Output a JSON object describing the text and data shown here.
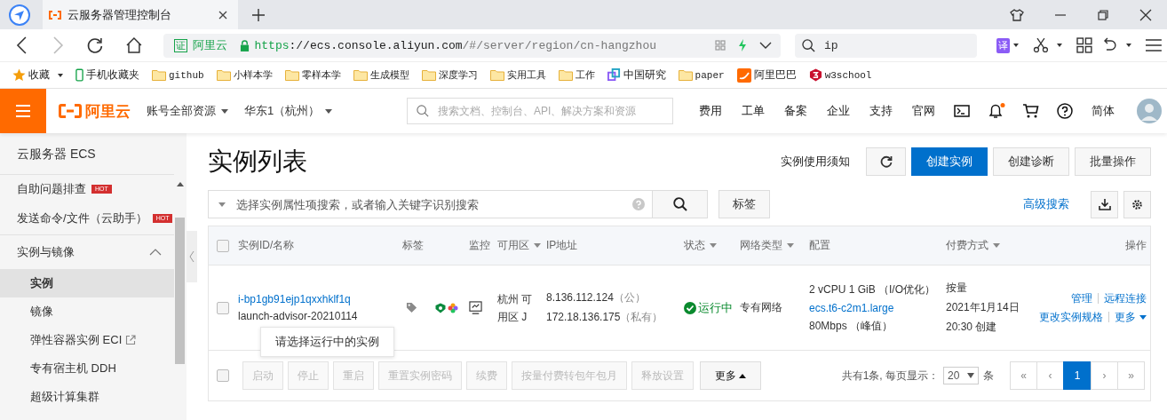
{
  "browser": {
    "tab_title": "云服务器管理控制台",
    "cert_badge": "证",
    "site_name": "阿里云",
    "url_scheme": "https",
    "url_host": "://ecs.console.aliyun.com",
    "url_path": "/#/server/region/cn-hangzhou",
    "search_value": "ip",
    "translate_badge": "译",
    "bookmarks": [
      {
        "kind": "star",
        "label": "收藏"
      },
      {
        "kind": "phone",
        "label": "手机收藏夹"
      },
      {
        "kind": "folder",
        "label": "github"
      },
      {
        "kind": "folder",
        "label": "小样本学"
      },
      {
        "kind": "folder",
        "label": "零样本学"
      },
      {
        "kind": "folder",
        "label": "生成模型"
      },
      {
        "kind": "folder",
        "label": "深度学习"
      },
      {
        "kind": "folder",
        "label": "实用工具"
      },
      {
        "kind": "folder",
        "label": "工作"
      },
      {
        "kind": "colorful",
        "label": "中国研究"
      },
      {
        "kind": "folder",
        "label": "paper"
      },
      {
        "kind": "alibaba",
        "label": "阿里巴巴"
      },
      {
        "kind": "w3",
        "label": "w3school"
      }
    ]
  },
  "header": {
    "logo": "阿里云",
    "account": "账号全部资源",
    "region": "华东1（杭州）",
    "search_placeholder": "搜索文档、控制台、API、解决方案和资源",
    "nav": [
      "费用",
      "工单",
      "备案",
      "企业",
      "支持",
      "官网"
    ],
    "notification": true,
    "language": "简体"
  },
  "sidebar": {
    "title": "云服务器 ECS",
    "items": [
      {
        "kind": "item",
        "label": "自助问题排查",
        "badge": "HOT"
      },
      {
        "kind": "item",
        "label": "发送命令/文件（云助手）",
        "badge": "HOT"
      },
      {
        "kind": "group",
        "label": "实例与镜像",
        "expanded": true,
        "children": [
          {
            "label": "实例",
            "selected": true,
            "external": false
          },
          {
            "label": "镜像",
            "selected": false,
            "external": false
          },
          {
            "label": "弹性容器实例 ECI",
            "selected": false,
            "external": true
          },
          {
            "label": "专有宿主机 DDH",
            "selected": false,
            "external": false
          },
          {
            "label": "超级计算集群",
            "selected": false,
            "external": false
          }
        ]
      }
    ]
  },
  "page": {
    "title": "实例列表",
    "notice": "实例使用须知",
    "buttons": [
      {
        "label": "创建实例",
        "primary": true
      },
      {
        "label": "创建诊断",
        "primary": false
      },
      {
        "label": "批量操作",
        "primary": false
      }
    ],
    "search_placeholder": "选择实例属性项搜索，或者输入关键字识别搜索",
    "tag_button": "标签",
    "advanced_search": "高级搜索"
  },
  "table": {
    "header_checked": false,
    "columns": [
      {
        "label": "实例ID/名称",
        "sortable": false
      },
      {
        "label": "标签",
        "sortable": false
      },
      {
        "label": "监控",
        "sortable": false
      },
      {
        "label": "可用区",
        "sortable": true
      },
      {
        "label": "IP地址",
        "sortable": false
      },
      {
        "label": "状态",
        "sortable": true
      },
      {
        "label": "网络类型",
        "sortable": true
      },
      {
        "label": "配置",
        "sortable": false
      },
      {
        "label": "付费方式",
        "sortable": true
      },
      {
        "label": "操作",
        "sortable": false
      }
    ],
    "rows": [
      {
        "checked": false,
        "id": "i-bp1gb91ejp1qxxhklf1q",
        "name": "launch-advisor-20210114",
        "zone": "杭州 可用区 J",
        "ip_public": "8.136.112.124",
        "ip_public_note": "（公）",
        "ip_private": "172.18.136.175",
        "ip_private_note": "（私有）",
        "status": "运行中",
        "running": true,
        "network": "专有网络",
        "config": "2 vCPU 1 GiB （I/O优化）",
        "spec": "ecs.t6-c2m1.large",
        "bandwidth": "80Mbps （峰值）",
        "billing": "按量",
        "created_date": "2021年1月14日",
        "created_time": "20:30 创建",
        "actions": [
          "管理",
          "远程连接",
          "更改实例规格",
          "更多"
        ]
      }
    ],
    "footer_checked": false,
    "bulk_buttons": [
      {
        "label": "启动",
        "disabled": true
      },
      {
        "label": "停止",
        "disabled": true
      },
      {
        "label": "重启",
        "disabled": true
      },
      {
        "label": "重置实例密码",
        "disabled": true
      },
      {
        "label": "续费",
        "disabled": true
      },
      {
        "label": "按量付费转包年包月",
        "disabled": true
      },
      {
        "label": "释放设置",
        "disabled": true
      },
      {
        "label": "更多",
        "disabled": false
      }
    ],
    "total_text": "共有1条, 每页显示：",
    "page_size": "20",
    "page_size_unit": "条",
    "pages": [
      {
        "label": "«",
        "selected": false
      },
      {
        "label": "‹",
        "selected": false
      },
      {
        "label": "1",
        "selected": true
      },
      {
        "label": "›",
        "selected": false
      },
      {
        "label": "»",
        "selected": false
      }
    ]
  },
  "tooltip": "请选择运行中的实例"
}
